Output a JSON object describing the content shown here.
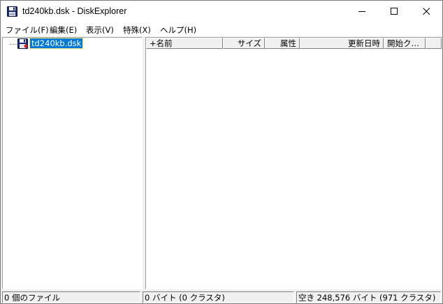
{
  "window": {
    "title": "td240kb.dsk - DiskExplorer",
    "icon": "floppy-disk-icon"
  },
  "menu": [
    {
      "label": "ファイル(F)"
    },
    {
      "label": "編集(E)"
    },
    {
      "label": "表示(V)"
    },
    {
      "label": "特殊(X)"
    },
    {
      "label": "ヘルプ(H)"
    }
  ],
  "tree": {
    "root_label": "td240kb.dsk",
    "root_icon": "floppy-disk-icon",
    "selected": true
  },
  "list": {
    "columns": [
      {
        "label": "+名前"
      },
      {
        "label": "サイズ"
      },
      {
        "label": "属性"
      },
      {
        "label": "更新日時"
      },
      {
        "label": "開始ク…"
      }
    ],
    "rows": []
  },
  "status": {
    "files": "0 個のファイル",
    "bytes": "0 バイト (0 クラスタ)",
    "free": "空き 248,576 バイト (971 クラスタ)"
  },
  "colors": {
    "selection": "#0078d7",
    "titlebar": "#ffffff",
    "chrome": "#f0f0f0"
  }
}
